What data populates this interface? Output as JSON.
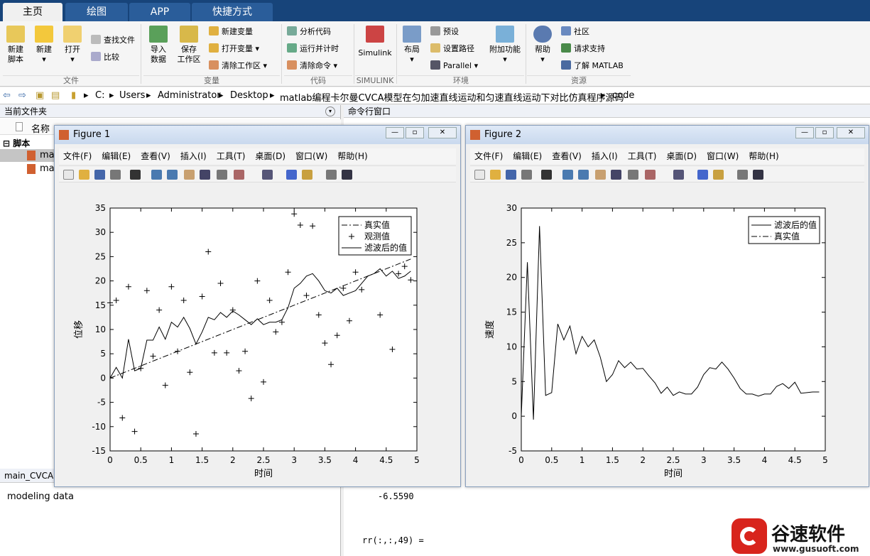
{
  "tabs": [
    "主页",
    "绘图",
    "APP",
    "快捷方式"
  ],
  "ribbon": {
    "file": {
      "new_script": "新建\n脚本",
      "new": "新建",
      "open": "打开",
      "find_files": "查找文件",
      "compare": "比较",
      "group": "文件"
    },
    "variable": {
      "import": "导入\n数据",
      "save_ws": "保存\n工作区",
      "new_var": "新建变量",
      "open_var": "打开变量",
      "clear_ws": "清除工作区",
      "group": "变量"
    },
    "code": {
      "analyze": "分析代码",
      "run_time": "运行并计时",
      "clear_cmd": "清除命令",
      "group": "代码"
    },
    "simulink": {
      "label": "Simulink",
      "group": "SIMULINK"
    },
    "env": {
      "layout": "布局",
      "prefs": "预设",
      "set_path": "设置路径",
      "parallel": "Parallel",
      "addons": "附加功能",
      "group": "环境"
    },
    "resources": {
      "help": "帮助",
      "community": "社区",
      "support": "请求支持",
      "learn": "了解 MATLAB",
      "group": "资源"
    }
  },
  "address": {
    "path": [
      "C:",
      "Users",
      "Administrator",
      "Desktop",
      "matlab编程卡尔曼CVCA模型在匀加速直线运动和匀速直线运动下对比仿真程序源码",
      "code"
    ]
  },
  "left": {
    "title": "当前文件夹",
    "col_name": "名称",
    "section": "脚本",
    "files": [
      "ma",
      "ma"
    ],
    "detail_title": "main_CVCA",
    "detail_text": "modeling data"
  },
  "cmd": {
    "title": "命令行窗口",
    "value": "-6.5590",
    "rr": "rr(:,:,49) ="
  },
  "watermark": {
    "name": "谷速软件",
    "url": "www.gusuoft.com"
  },
  "figures": [
    {
      "title": "Figure 1",
      "menu": [
        "文件(F)",
        "编辑(E)",
        "查看(V)",
        "插入(I)",
        "工具(T)",
        "桌面(D)",
        "窗口(W)",
        "帮助(H)"
      ]
    },
    {
      "title": "Figure 2",
      "menu": [
        "文件(F)",
        "编辑(E)",
        "查看(V)",
        "插入(I)",
        "工具(T)",
        "桌面(D)",
        "窗口(W)",
        "帮助(H)"
      ]
    }
  ],
  "chart_data": [
    {
      "type": "line",
      "xlabel": "时间",
      "ylabel": "位移",
      "xlim": [
        0,
        5
      ],
      "ylim": [
        -15,
        35
      ],
      "xticks": [
        "0",
        "0.5",
        "1",
        "1.5",
        "2",
        "2.5",
        "3",
        "3.5",
        "4",
        "4.5",
        "5"
      ],
      "yticks": [
        "-15",
        "-10",
        "-5",
        "0",
        "5",
        "10",
        "15",
        "20",
        "25",
        "30",
        "35"
      ],
      "legend": [
        "真实值",
        "观测值",
        "滤波后的值"
      ],
      "legend_position": "top-right",
      "series": [
        {
          "name": "真实值",
          "style": "dashdot",
          "x": [
            0,
            4.9
          ],
          "values": [
            0,
            24.5
          ]
        },
        {
          "name": "观测值",
          "style": "marker-plus",
          "x": [
            0,
            0.1,
            0.2,
            0.3,
            0.4,
            0.5,
            0.6,
            0.7,
            0.8,
            0.9,
            1.0,
            1.1,
            1.2,
            1.3,
            1.4,
            1.5,
            1.6,
            1.7,
            1.8,
            1.9,
            2.0,
            2.1,
            2.2,
            2.3,
            2.4,
            2.5,
            2.6,
            2.7,
            2.8,
            2.9,
            3.0,
            3.1,
            3.2,
            3.3,
            3.4,
            3.5,
            3.6,
            3.7,
            3.8,
            3.9,
            4.0,
            4.1,
            4.4,
            4.6,
            4.7,
            4.8,
            4.9
          ],
          "values": [
            15.5,
            16,
            -8.2,
            18.8,
            -11,
            2,
            18,
            4.5,
            14,
            -1.5,
            18.8,
            5.5,
            16,
            1.2,
            -11.5,
            16.8,
            26,
            5.2,
            19.5,
            5.2,
            14,
            1.5,
            5.5,
            -4.2,
            20,
            -0.8,
            16,
            9.5,
            11.5,
            21.8,
            33.8,
            31.5,
            17,
            31.3,
            13,
            7.2,
            2.8,
            8.8,
            18.5,
            11.8,
            21.8,
            18.2,
            13,
            5.9,
            21.5,
            23,
            20.2
          ]
        },
        {
          "name": "滤波后的值",
          "style": "solid",
          "x": [
            0,
            0.1,
            0.2,
            0.3,
            0.4,
            0.5,
            0.6,
            0.7,
            0.8,
            0.9,
            1.0,
            1.1,
            1.2,
            1.3,
            1.4,
            1.5,
            1.6,
            1.7,
            1.8,
            1.9,
            2.0,
            2.1,
            2.2,
            2.3,
            2.4,
            2.5,
            2.6,
            2.7,
            2.8,
            2.9,
            3.0,
            3.1,
            3.2,
            3.3,
            3.4,
            3.5,
            3.6,
            3.7,
            3.8,
            3.9,
            4.0,
            4.1,
            4.2,
            4.3,
            4.4,
            4.5,
            4.6,
            4.7,
            4.8,
            4.9
          ],
          "values": [
            0,
            2.2,
            0,
            8,
            1.5,
            2,
            7.8,
            7.8,
            10.5,
            8,
            11.5,
            10.5,
            12.5,
            10.2,
            7,
            9.5,
            12.5,
            12,
            13.5,
            12.5,
            13.8,
            13,
            12,
            11,
            12.2,
            11,
            11.5,
            11.5,
            12,
            14.5,
            18.5,
            19.5,
            21,
            21.5,
            20,
            18,
            17.5,
            18.5,
            17,
            17.5,
            18,
            19.5,
            21,
            21.5,
            22.5,
            21,
            22,
            20.5,
            21,
            22
          ]
        }
      ]
    },
    {
      "type": "line",
      "xlabel": "时间",
      "ylabel": "速度",
      "xlim": [
        0,
        5
      ],
      "ylim": [
        -5,
        30
      ],
      "xticks": [
        "0",
        "0.5",
        "1",
        "1.5",
        "2",
        "2.5",
        "3",
        "3.5",
        "4",
        "4.5",
        "5"
      ],
      "yticks": [
        "-5",
        "0",
        "5",
        "10",
        "15",
        "20",
        "25",
        "30"
      ],
      "legend": [
        "滤波后的值",
        "真实值"
      ],
      "legend_position": "top-right",
      "series": [
        {
          "name": "滤波后的值",
          "style": "solid",
          "x": [
            0,
            0.1,
            0.2,
            0.3,
            0.4,
            0.5,
            0.6,
            0.7,
            0.8,
            0.9,
            1.0,
            1.1,
            1.2,
            1.3,
            1.4,
            1.5,
            1.6,
            1.7,
            1.8,
            1.9,
            2.0,
            2.1,
            2.2,
            2.3,
            2.4,
            2.5,
            2.6,
            2.7,
            2.8,
            2.9,
            3.0,
            3.1,
            3.2,
            3.3,
            3.4,
            3.5,
            3.6,
            3.7,
            3.8,
            3.9,
            4.0,
            4.1,
            4.2,
            4.3,
            4.4,
            4.5,
            4.6,
            4.7,
            4.8,
            4.9
          ],
          "values": [
            0,
            22.2,
            -0.5,
            27.4,
            3,
            3.4,
            13.3,
            11,
            13,
            9,
            11.5,
            10,
            11,
            8.5,
            5,
            6,
            8,
            7,
            7.8,
            6.8,
            6.9,
            5.8,
            4.8,
            3.3,
            4.2,
            3,
            3.5,
            3.2,
            3.2,
            4.2,
            6,
            7,
            6.8,
            7.8,
            6.8,
            5.5,
            4,
            3.2,
            3.2,
            2.9,
            3.2,
            3.2,
            4.3,
            4.7,
            4,
            4.9,
            3.3,
            3.4,
            3.5,
            3.5
          ]
        },
        {
          "name": "真实值",
          "style": "dashdot",
          "x": [],
          "values": []
        }
      ]
    }
  ]
}
